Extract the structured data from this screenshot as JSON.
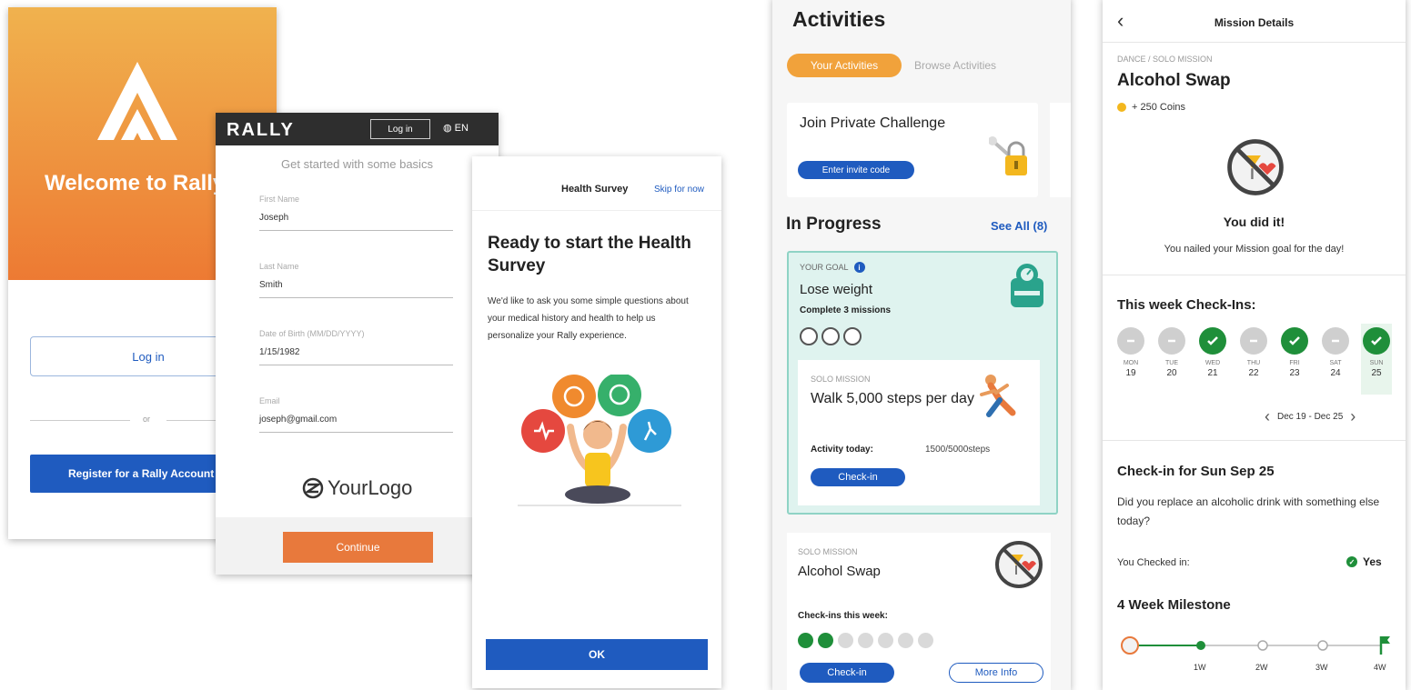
{
  "welcome": {
    "title": "Welcome to Rally",
    "login_label": "Log in",
    "or_label": "or",
    "register_label": "Register for a Rally Account",
    "colors": {
      "top": "#f0b24e",
      "bottom": "#ed7a33",
      "primary": "#1f5bbf"
    }
  },
  "register": {
    "brand": "RALLY",
    "login_label": "Log in",
    "lang_label": "EN",
    "subtitle": "Get started with some basics",
    "fields": [
      {
        "label": "First Name",
        "value": "Joseph"
      },
      {
        "label": "Last Name",
        "value": "Smith"
      },
      {
        "label": "Date of Birth (MM/DD/YYYY)",
        "value": "1/15/1982"
      },
      {
        "label": "Email",
        "value": "joseph@gmail.com"
      }
    ],
    "logo_text": "YourLogo",
    "continue_label": "Continue"
  },
  "survey": {
    "header_title": "Health Survey",
    "skip_label": "Skip for now",
    "heading": "Ready to start the Health Survey",
    "body": "We'd like to ask you some simple questions about your medical history and health to help us personalize your Rally experience.",
    "ok_label": "OK"
  },
  "activities": {
    "title": "Activities",
    "tabs": [
      "Your Activities",
      "Browse Activities"
    ],
    "private_challenge": {
      "title": "Join Private Challenge",
      "button": "Enter invite code"
    },
    "in_progress_label": "In Progress",
    "see_all_label": "See All (8)",
    "goal": {
      "label": "YOUR GOAL",
      "title": "Lose weight",
      "subtitle": "Complete 3 missions",
      "mission": {
        "label": "SOLO MISSION",
        "title": "Walk 5,000 steps per day",
        "activity_label": "Activity today:",
        "activity_value": "1500/5000steps",
        "checkin_label": "Check-in"
      }
    },
    "alcohol": {
      "label": "SOLO MISSION",
      "title": "Alcohol Swap",
      "checkins_label": "Check-ins this week:",
      "checkins_done": 2,
      "checkins_total": 7,
      "checkin_label": "Check-in",
      "more_label": "More Info"
    },
    "colors": {
      "tab": "#f1a23b",
      "goal_bg": "#dff3ef",
      "check": "#1f8f3a"
    }
  },
  "mission": {
    "header_title": "Mission Details",
    "category": "DANCE / SOLO MISSION",
    "name": "Alcohol Swap",
    "coins": "+ 250 Coins",
    "did_it": "You did it!",
    "nailed": "You nailed your Mission goal for the day!",
    "week_title": "This week Check-Ins:",
    "days": [
      {
        "name": "MON",
        "date": "19",
        "status": "none"
      },
      {
        "name": "TUE",
        "date": "20",
        "status": "none"
      },
      {
        "name": "WED",
        "date": "21",
        "status": "done"
      },
      {
        "name": "THU",
        "date": "22",
        "status": "none"
      },
      {
        "name": "FRI",
        "date": "23",
        "status": "done"
      },
      {
        "name": "SAT",
        "date": "24",
        "status": "none"
      },
      {
        "name": "SUN",
        "date": "25",
        "status": "done"
      }
    ],
    "range": "Dec 19 - Dec 25",
    "checkin_title": "Check-in for Sun Sep 25",
    "question": "Did you replace an alcoholic drink with something else today?",
    "checked_in_label": "You Checked in:",
    "checked_in_value": "Yes",
    "milestone_title": "4 Week Milestone",
    "milestones": [
      "1W",
      "2W",
      "3W",
      "4W"
    ]
  }
}
